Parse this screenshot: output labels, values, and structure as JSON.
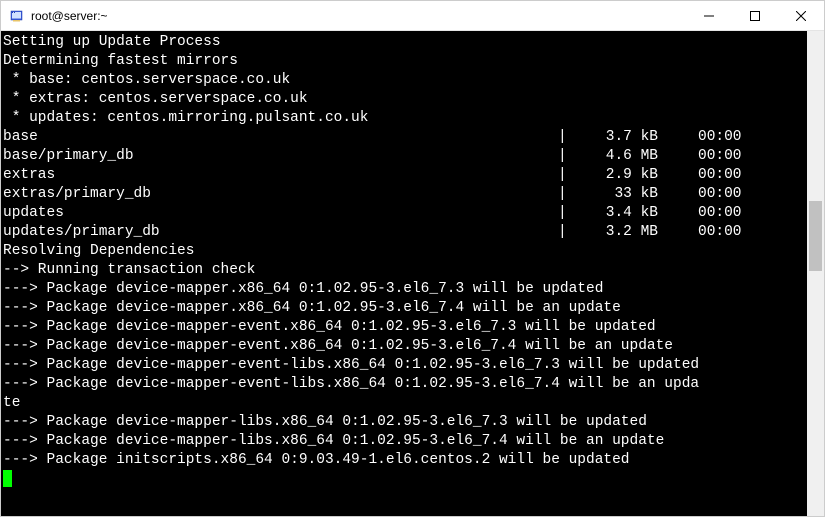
{
  "window": {
    "title": "root@server:~"
  },
  "icon": {
    "name": "putty-icon"
  },
  "terminal": {
    "lines_pre": [
      "Setting up Update Process",
      "Determining fastest mirrors",
      " * base: centos.serverspace.co.uk",
      " * extras: centos.serverspace.co.uk",
      " * updates: centos.mirroring.pulsant.co.uk"
    ],
    "repos": [
      {
        "name": "base",
        "size": "3.7 kB",
        "time": "00:00"
      },
      {
        "name": "base/primary_db",
        "size": "4.6 MB",
        "time": "00:00"
      },
      {
        "name": "extras",
        "size": "2.9 kB",
        "time": "00:00"
      },
      {
        "name": "extras/primary_db",
        "size": " 33 kB",
        "time": "00:00"
      },
      {
        "name": "updates",
        "size": "3.4 kB",
        "time": "00:00"
      },
      {
        "name": "updates/primary_db",
        "size": "3.2 MB",
        "time": "00:00"
      }
    ],
    "lines_post": [
      "Resolving Dependencies",
      "--> Running transaction check",
      "---> Package device-mapper.x86_64 0:1.02.95-3.el6_7.3 will be updated",
      "---> Package device-mapper.x86_64 0:1.02.95-3.el6_7.4 will be an update",
      "---> Package device-mapper-event.x86_64 0:1.02.95-3.el6_7.3 will be updated",
      "---> Package device-mapper-event.x86_64 0:1.02.95-3.el6_7.4 will be an update",
      "---> Package device-mapper-event-libs.x86_64 0:1.02.95-3.el6_7.3 will be updated",
      "---> Package device-mapper-event-libs.x86_64 0:1.02.95-3.el6_7.4 will be an upda",
      "te",
      "---> Package device-mapper-libs.x86_64 0:1.02.95-3.el6_7.3 will be updated",
      "---> Package device-mapper-libs.x86_64 0:1.02.95-3.el6_7.4 will be an update",
      "---> Package initscripts.x86_64 0:9.03.49-1.el6.centos.2 will be updated"
    ]
  }
}
